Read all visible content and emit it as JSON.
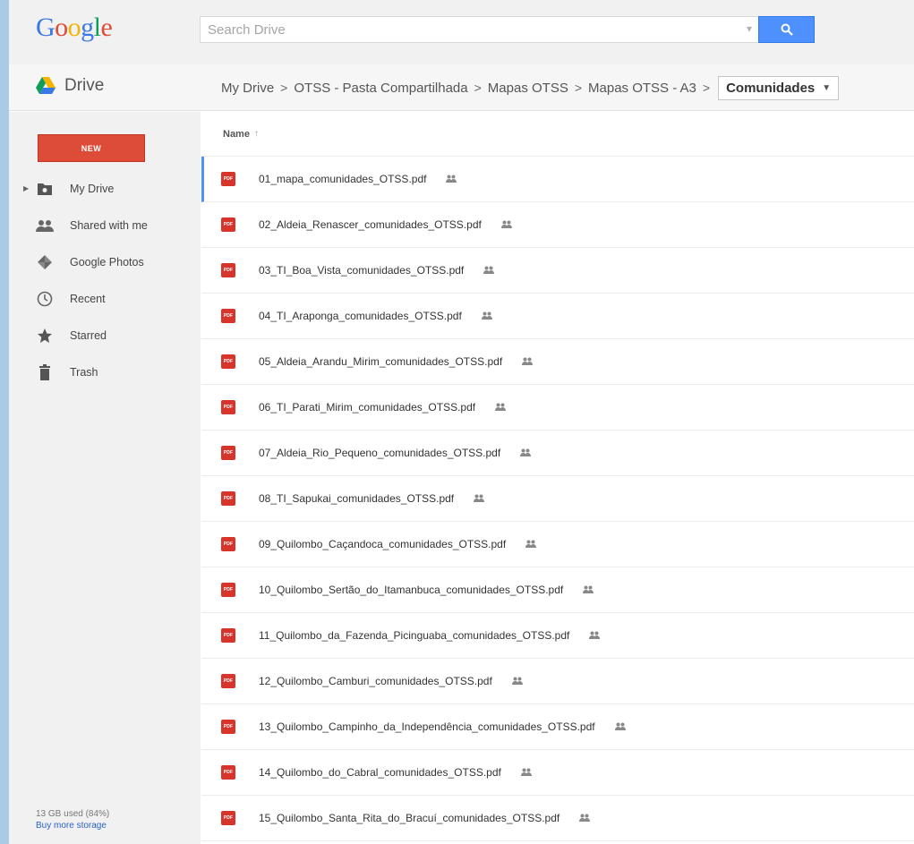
{
  "header": {
    "logo_letters": [
      {
        "ch": "G",
        "color": "#3b78e7"
      },
      {
        "ch": "o",
        "color": "#dd4b39"
      },
      {
        "ch": "o",
        "color": "#f4b400"
      },
      {
        "ch": "g",
        "color": "#3b78e7"
      },
      {
        "ch": "l",
        "color": "#0f9d58"
      },
      {
        "ch": "e",
        "color": "#dd4b39"
      }
    ],
    "search_placeholder": "Search Drive",
    "search_button_icon": "search-icon"
  },
  "subbar": {
    "app_name": "Drive",
    "breadcrumb": [
      "My Drive",
      "OTSS - Pasta Compartilhada",
      "Mapas OTSS",
      "Mapas OTSS - A3"
    ],
    "current_folder": "Comunidades"
  },
  "sidebar": {
    "new_label": "NEW",
    "items": [
      {
        "label": "My Drive",
        "icon": "folder-icon"
      },
      {
        "label": "Shared with me",
        "icon": "people-icon"
      },
      {
        "label": "Google Photos",
        "icon": "photos-icon"
      },
      {
        "label": "Recent",
        "icon": "clock-icon"
      },
      {
        "label": "Starred",
        "icon": "star-icon"
      },
      {
        "label": "Trash",
        "icon": "trash-icon"
      }
    ],
    "storage_used": "13 GB used (84%)",
    "storage_link": "Buy more storage"
  },
  "list": {
    "column_name": "Name",
    "sort_indicator": "↑",
    "file_icon_label": "PDF",
    "files": [
      "01_mapa_comunidades_OTSS.pdf",
      "02_Aldeia_Renascer_comunidades_OTSS.pdf",
      "03_TI_Boa_Vista_comunidades_OTSS.pdf",
      "04_TI_Araponga_comunidades_OTSS.pdf",
      "05_Aldeia_Arandu_Mirim_comunidades_OTSS.pdf",
      "06_TI_Parati_Mirim_comunidades_OTSS.pdf",
      "07_Aldeia_Rio_Pequeno_comunidades_OTSS.pdf",
      "08_TI_Sapukai_comunidades_OTSS.pdf",
      "09_Quilombo_Caçandoca_comunidades_OTSS.pdf",
      "10_Quilombo_Sertão_do_Itamanbuca_comunidades_OTSS.pdf",
      "11_Quilombo_da_Fazenda_Picinguaba_comunidades_OTSS.pdf",
      "12_Quilombo_Camburi_comunidades_OTSS.pdf",
      "13_Quilombo_Campinho_da_Independência_comunidades_OTSS.pdf",
      "14_Quilombo_do_Cabral_comunidades_OTSS.pdf",
      "15_Quilombo_Santa_Rita_do_Bracuí_comunidades_OTSS.pdf"
    ]
  },
  "colors": {
    "accent_blue": "#4d90fe",
    "new_button_red": "#dd4b39",
    "pdf_red": "#d7342b"
  }
}
